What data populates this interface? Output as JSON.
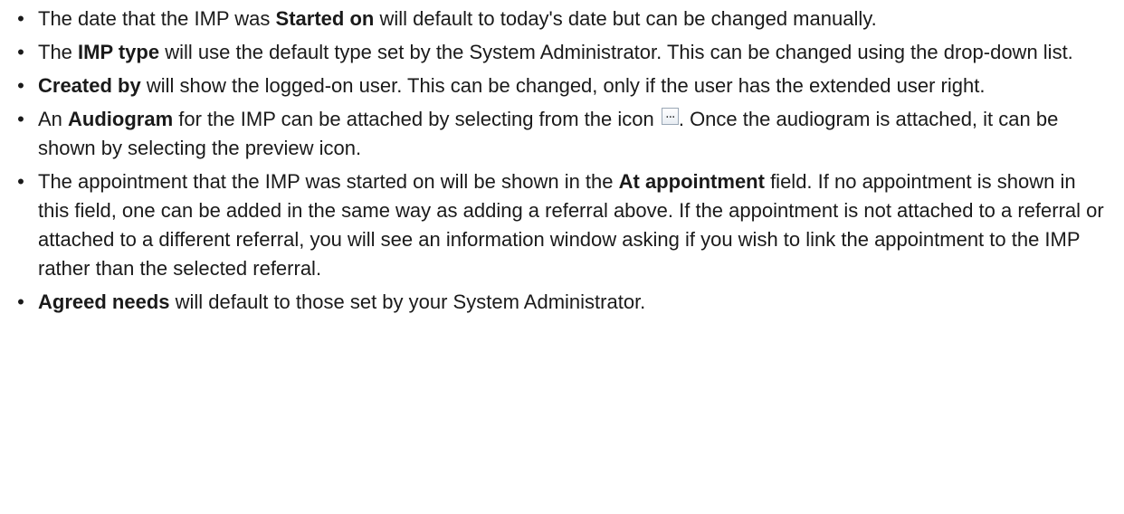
{
  "bullets": [
    {
      "marker": "•",
      "pre": "The date that the IMP was ",
      "bold": "Started on",
      "post": " will default to today's date but can be changed manually."
    },
    {
      "marker": "•",
      "pre": "The ",
      "bold": "IMP type",
      "post": " will use the default type set by the System Administrator. This can be changed using the drop-down list."
    },
    {
      "marker": "•",
      "pre": "",
      "bold": "Created by",
      "post": " will show the logged-on user. This can be changed, only if the user has the extended user right."
    },
    {
      "marker": "•",
      "pre": "An ",
      "bold": "Audiogram",
      "post": " for the IMP can be attached by selecting from the icon",
      "icon": "ellipsis-button-icon",
      "post2": ". Once the audiogram is attached, it can be shown by selecting the preview icon."
    },
    {
      "marker": "•",
      "pre": "The appointment that the IMP was started on will be shown in the ",
      "bold": "At appointment",
      "post": " field. If no appointment is shown in this field, one can be added in the same way as adding a referral above. If the appointment is not attached to a referral or attached to a different referral, you will see an information window asking if you wish to link the appointment to the IMP rather than the selected referral."
    },
    {
      "marker": "•",
      "pre": "",
      "bold": "Agreed needs",
      "post": " will default to those set by your System Administrator."
    }
  ]
}
